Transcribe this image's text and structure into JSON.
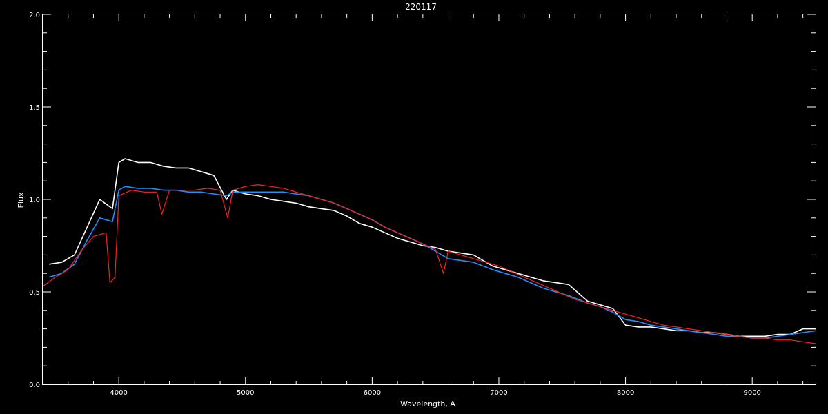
{
  "chart_data": {
    "type": "line",
    "title": "220117",
    "xlabel": "Wavelength, A",
    "ylabel": "Flux",
    "xlim": [
      3400,
      9500
    ],
    "ylim": [
      0.0,
      2.0
    ],
    "xticks": [
      4000,
      5000,
      6000,
      7000,
      8000,
      9000
    ],
    "xtick_labels": [
      "4000",
      "5000",
      "6000",
      "7000",
      "8000",
      "9000"
    ],
    "yticks": [
      0.0,
      0.5,
      1.0,
      1.5,
      2.0
    ],
    "ytick_labels": [
      "0.0",
      "0.5",
      "1.0",
      "1.5",
      "2.0"
    ],
    "grid": false,
    "background": "#000000",
    "series": [
      {
        "color": "#ffffff",
        "x": [
          3450,
          3550,
          3650,
          3750,
          3850,
          3950,
          4000,
          4050,
          4150,
          4250,
          4350,
          4450,
          4550,
          4650,
          4750,
          4850,
          4900,
          5000,
          5100,
          5200,
          5300,
          5400,
          5500,
          5600,
          5700,
          5800,
          5900,
          6000,
          6100,
          6200,
          6300,
          6400,
          6500,
          6600,
          6700,
          6800,
          6950,
          7050,
          7150,
          7250,
          7350,
          7450,
          7550,
          7700,
          7800,
          7900,
          8000,
          8100,
          8200,
          8300,
          8400,
          8500,
          8600,
          8700,
          8800,
          8900,
          9000,
          9100,
          9200,
          9300,
          9400,
          9500
        ],
        "y": [
          0.65,
          0.66,
          0.7,
          0.85,
          1.0,
          0.95,
          1.2,
          1.22,
          1.2,
          1.2,
          1.18,
          1.17,
          1.17,
          1.15,
          1.13,
          1.0,
          1.05,
          1.03,
          1.02,
          1.0,
          0.99,
          0.98,
          0.96,
          0.95,
          0.94,
          0.91,
          0.87,
          0.85,
          0.82,
          0.79,
          0.77,
          0.75,
          0.74,
          0.72,
          0.71,
          0.7,
          0.64,
          0.62,
          0.6,
          0.58,
          0.56,
          0.55,
          0.54,
          0.45,
          0.43,
          0.41,
          0.32,
          0.31,
          0.31,
          0.3,
          0.29,
          0.29,
          0.28,
          0.28,
          0.27,
          0.26,
          0.26,
          0.26,
          0.27,
          0.27,
          0.3,
          0.3
        ]
      },
      {
        "color": "#1e90ff",
        "x": [
          3450,
          3550,
          3650,
          3750,
          3850,
          3950,
          4000,
          4050,
          4150,
          4250,
          4350,
          4450,
          4550,
          4650,
          4750,
          4850,
          4900,
          5000,
          5100,
          5200,
          5300,
          5400,
          5500,
          5600,
          5700,
          5800,
          5900,
          6000,
          6100,
          6200,
          6300,
          6400,
          6500,
          6600,
          6700,
          6800,
          6950,
          7050,
          7150,
          7250,
          7350,
          7450,
          7550,
          7700,
          7800,
          7900,
          8000,
          8100,
          8200,
          8300,
          8400,
          8500,
          8600,
          8700,
          8800,
          8900,
          9000,
          9100,
          9200,
          9300,
          9400,
          9500
        ],
        "y": [
          0.58,
          0.6,
          0.65,
          0.78,
          0.9,
          0.88,
          1.05,
          1.07,
          1.06,
          1.06,
          1.05,
          1.05,
          1.04,
          1.04,
          1.03,
          1.02,
          1.04,
          1.04,
          1.04,
          1.04,
          1.04,
          1.03,
          1.02,
          1.0,
          0.98,
          0.95,
          0.92,
          0.89,
          0.85,
          0.82,
          0.79,
          0.76,
          0.72,
          0.68,
          0.67,
          0.66,
          0.62,
          0.6,
          0.58,
          0.55,
          0.52,
          0.5,
          0.48,
          0.44,
          0.42,
          0.39,
          0.35,
          0.34,
          0.32,
          0.31,
          0.3,
          0.29,
          0.28,
          0.27,
          0.26,
          0.26,
          0.25,
          0.25,
          0.26,
          0.27,
          0.28,
          0.29
        ]
      },
      {
        "color": "#ff2020",
        "x": [
          3400,
          3500,
          3600,
          3700,
          3800,
          3900,
          3930,
          3970,
          4000,
          4100,
          4200,
          4300,
          4340,
          4400,
          4500,
          4600,
          4700,
          4800,
          4860,
          4900,
          5000,
          5100,
          5200,
          5300,
          5400,
          5500,
          5600,
          5700,
          5800,
          5900,
          6000,
          6100,
          6200,
          6300,
          6400,
          6500,
          6563,
          6600,
          6700,
          6800,
          6900,
          7000,
          7100,
          7200,
          7300,
          7400,
          7500,
          7600,
          7700,
          7800,
          7900,
          8000,
          8100,
          8200,
          8300,
          8400,
          8500,
          8600,
          8700,
          8800,
          8900,
          9000,
          9100,
          9200,
          9300,
          9400,
          9500
        ],
        "y": [
          0.53,
          0.58,
          0.62,
          0.72,
          0.8,
          0.82,
          0.55,
          0.58,
          1.02,
          1.05,
          1.04,
          1.04,
          0.92,
          1.05,
          1.05,
          1.05,
          1.06,
          1.05,
          0.9,
          1.05,
          1.07,
          1.08,
          1.07,
          1.06,
          1.04,
          1.02,
          1.0,
          0.98,
          0.95,
          0.92,
          0.89,
          0.85,
          0.82,
          0.79,
          0.76,
          0.73,
          0.6,
          0.72,
          0.7,
          0.68,
          0.66,
          0.64,
          0.61,
          0.58,
          0.55,
          0.52,
          0.49,
          0.46,
          0.44,
          0.42,
          0.4,
          0.38,
          0.36,
          0.34,
          0.32,
          0.31,
          0.3,
          0.29,
          0.28,
          0.27,
          0.26,
          0.25,
          0.25,
          0.24,
          0.24,
          0.23,
          0.22
        ]
      }
    ]
  }
}
